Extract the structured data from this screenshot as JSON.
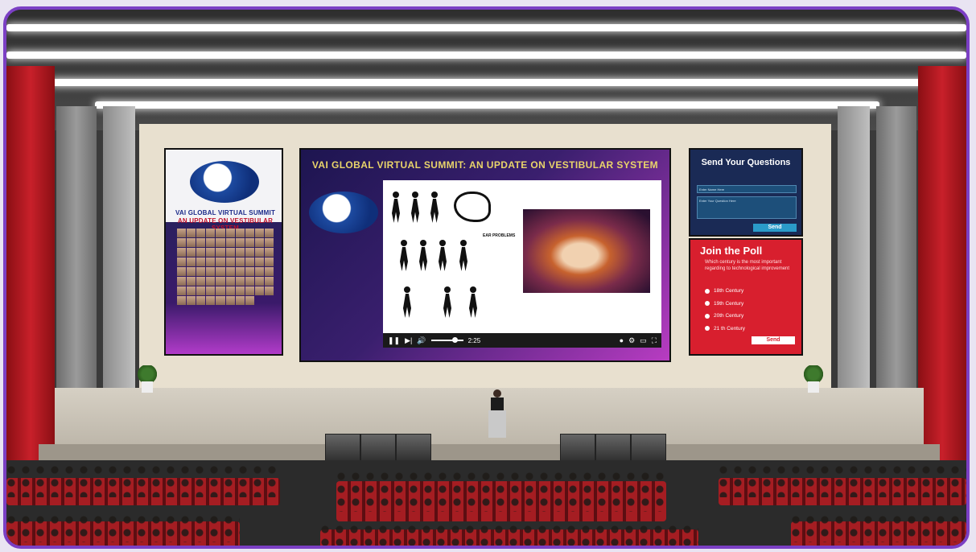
{
  "left_poster": {
    "title_line1": "VAI GLOBAL VIRTUAL SUMMIT",
    "title_line2": "AN UPDATE ON VESTIBULAR SYSTEM"
  },
  "main_screen": {
    "title": "VAI GLOBAL VIRTUAL SUMMIT: AN UPDATE ON VESTIBULAR SYSTEM",
    "slide_label": "EAR PROBLEMS",
    "player": {
      "time": "2:25",
      "play_icon": "pause-icon",
      "next_icon": "skip-next-icon",
      "volume_icon": "volume-icon",
      "settings_icon": "gear-icon",
      "fullscreen_icon": "fullscreen-icon"
    }
  },
  "questions_panel": {
    "title": "Send Your Questions",
    "name_placeholder": "Enter Name Here",
    "question_placeholder": "Enter Your Question Here",
    "send_label": "Send"
  },
  "poll_panel": {
    "title": "Join the Poll",
    "question": "Which century is the most important regarding to technological improvement",
    "options": [
      "18th Century",
      "19th Century",
      "20th Century",
      "21 th Century"
    ],
    "send_label": "Send"
  },
  "colors": {
    "frame_border": "#7b3fc4",
    "curtain": "#c8202a",
    "poll_bg": "#d81f2e",
    "questions_bg": "#1a2a55",
    "title_gold": "#e9d46a"
  }
}
